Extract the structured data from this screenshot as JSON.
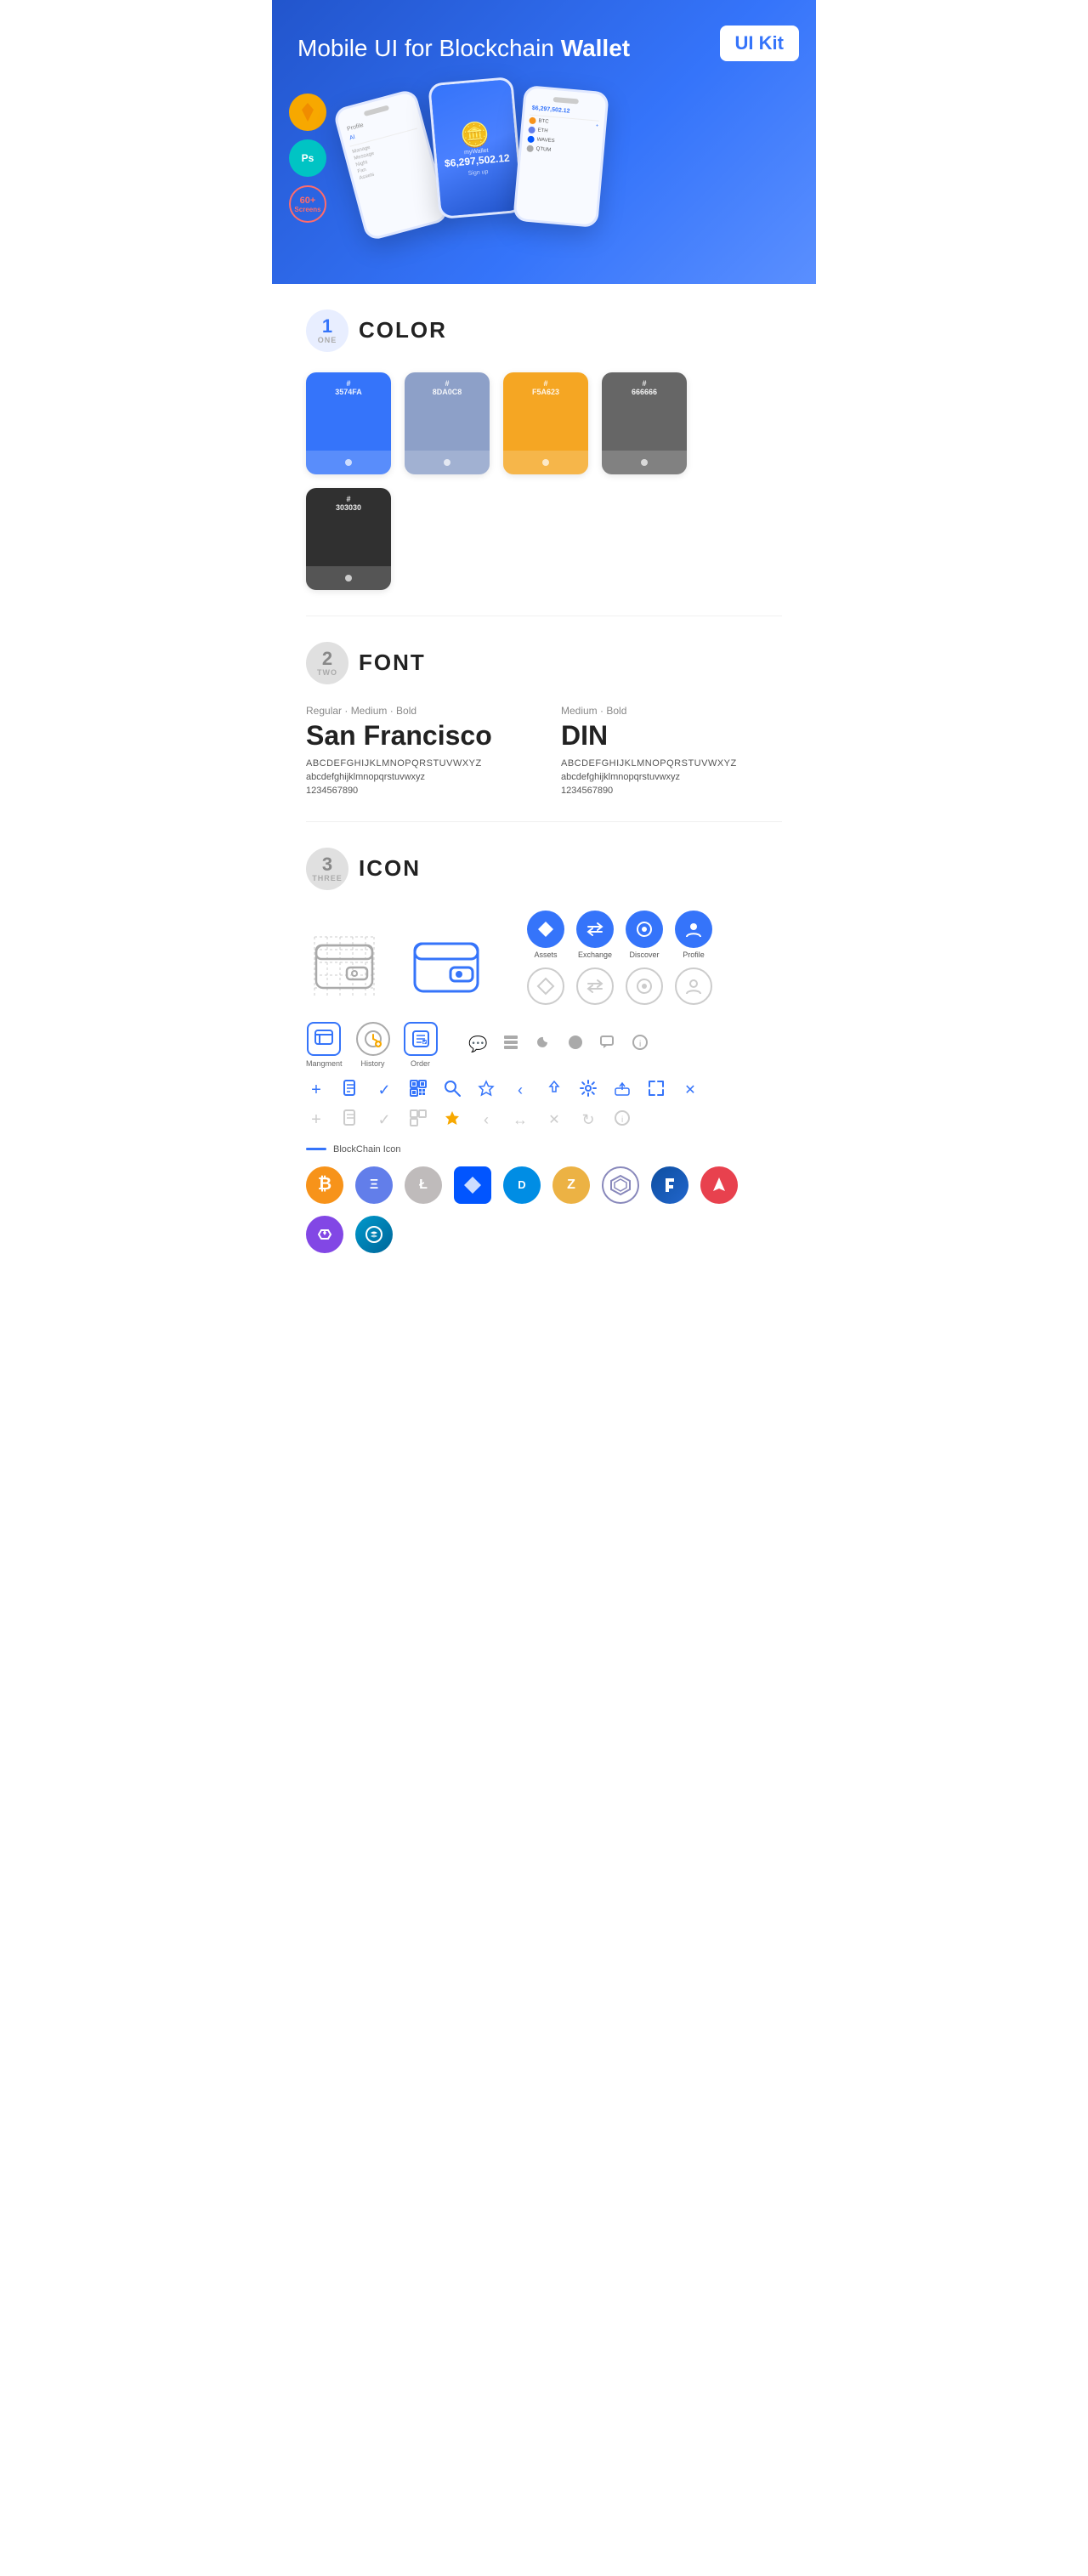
{
  "hero": {
    "title": "Mobile UI for Blockchain ",
    "title_bold": "Wallet",
    "badge": "UI Kit",
    "sketch_label": "Sk",
    "ps_label": "Ps",
    "screens_count": "60+",
    "screens_label": "Screens"
  },
  "sections": {
    "color": {
      "number": "1",
      "sub": "ONE",
      "title": "COLOR",
      "swatches": [
        {
          "hex": "#3574FA",
          "label": "#\n3574FA",
          "dark": false
        },
        {
          "hex": "#8DA0C8",
          "label": "#\n8DA0C8",
          "dark": false
        },
        {
          "hex": "#F5A623",
          "label": "#\nF5A623",
          "dark": false
        },
        {
          "hex": "#666666",
          "label": "#\n666666",
          "dark": false
        },
        {
          "hex": "#303030",
          "label": "#\n303030",
          "dark": false
        }
      ]
    },
    "font": {
      "number": "2",
      "sub": "TWO",
      "title": "FONT",
      "left": {
        "type": "Regular · Medium · Bold",
        "name": "San Francisco",
        "uppercase": "ABCDEFGHIJKLMNOPQRSTUVWXYZ",
        "lowercase": "abcdefghijklmnopqrstuvwxyz",
        "numbers": "1234567890"
      },
      "right": {
        "type": "Medium · Bold",
        "name": "DIN",
        "uppercase": "ABCDEFGHIJKLMNOPQRSTUVWXYZ",
        "lowercase": "abcdefghijklmnopqrstuvwxyz",
        "numbers": "1234567890"
      }
    },
    "icon": {
      "number": "3",
      "sub": "THREE",
      "title": "ICON",
      "nav_icons": [
        {
          "label": "Assets",
          "symbol": "◆"
        },
        {
          "label": "Exchange",
          "symbol": "⇄"
        },
        {
          "label": "Discover",
          "symbol": "●"
        },
        {
          "label": "Profile",
          "symbol": "👤"
        }
      ],
      "bottom_icons": [
        {
          "label": "Mangment",
          "type": "box"
        },
        {
          "label": "History",
          "type": "clock"
        },
        {
          "label": "Order",
          "type": "list"
        }
      ],
      "blockchain_label": "BlockChain Icon",
      "crypto": [
        {
          "label": "BTC",
          "class": "coin-btc",
          "symbol": "₿"
        },
        {
          "label": "ETH",
          "class": "coin-eth",
          "symbol": "Ξ"
        },
        {
          "label": "LTC",
          "class": "coin-ltc",
          "symbol": "Ł"
        },
        {
          "label": "WAVES",
          "class": "coin-waves",
          "symbol": "W"
        },
        {
          "label": "DASH",
          "class": "coin-dash",
          "symbol": "D"
        },
        {
          "label": "ZEC",
          "class": "coin-zcash",
          "symbol": "Z"
        },
        {
          "label": "GRID",
          "class": "coin-grid",
          "symbol": "✦"
        },
        {
          "label": "LSK",
          "class": "coin-lisk",
          "symbol": "L"
        },
        {
          "label": "ARK",
          "class": "coin-ark",
          "symbol": "A"
        },
        {
          "label": "MATIC",
          "class": "coin-matic",
          "symbol": "M"
        },
        {
          "label": "STRAT",
          "class": "coin-stratis",
          "symbol": "S"
        }
      ]
    }
  }
}
